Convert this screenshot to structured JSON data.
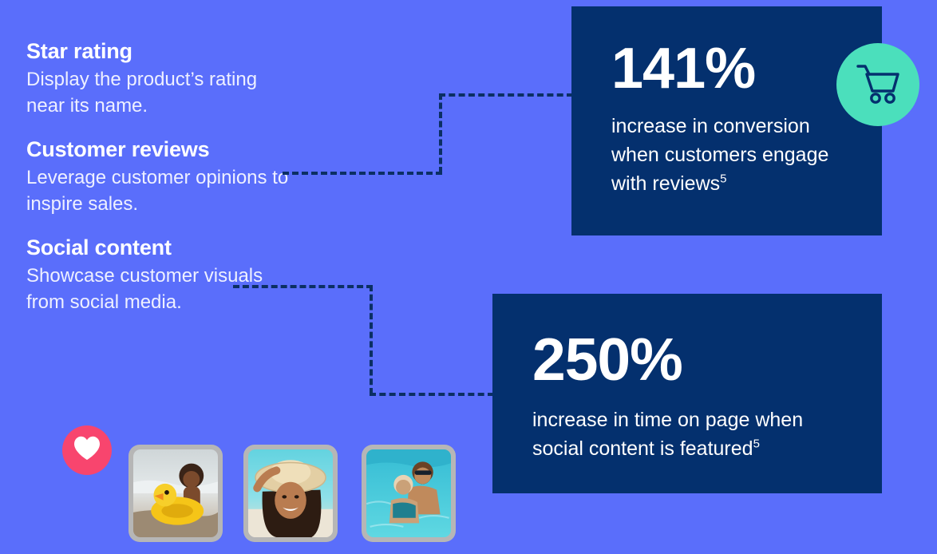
{
  "theme": {
    "background": "#5a6efb",
    "card_navy": "#04306e",
    "accent_mint": "#4bdfbc",
    "accent_pink": "#f8456e",
    "text_white": "#ffffff",
    "connector": "#0b2f63",
    "photo_frame": "#b6b6b6"
  },
  "features": [
    {
      "title": "Star rating",
      "description": "Display the product’s rating near its name."
    },
    {
      "title": "Customer reviews",
      "description": "Leverage customer opinions to inspire sales."
    },
    {
      "title": "Social content",
      "description": "Showcase customer visuals from social media."
    }
  ],
  "stats": [
    {
      "number": "141%",
      "description": "increase in conversion when customers engage with reviews",
      "footnote": "5",
      "icon": "shopping-cart-icon"
    },
    {
      "number": "250%",
      "description": "increase in time on page when social content is featured",
      "footnote": "5",
      "icon": null
    }
  ],
  "badges": [
    {
      "name": "heart-badge",
      "icon": "heart-icon",
      "color": "#f8456e"
    },
    {
      "name": "cart-badge",
      "icon": "shopping-cart-icon",
      "color": "#4bdfbc"
    }
  ],
  "photos": [
    {
      "alt": "child with yellow duck float at the beach"
    },
    {
      "alt": "woman in straw hat smiling at the beach"
    },
    {
      "alt": "couple in a swimming pool"
    }
  ]
}
